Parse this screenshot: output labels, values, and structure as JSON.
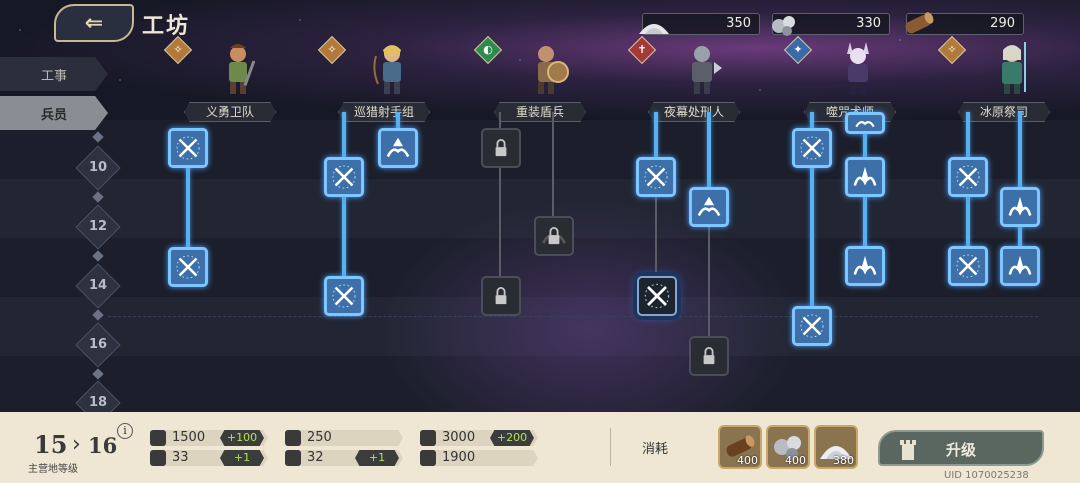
{
  "header": {
    "title": "工坊",
    "back_label": "⇐"
  },
  "resources": [
    {
      "name": "silver-sand",
      "value": "350"
    },
    {
      "name": "iron-ore",
      "value": "330"
    },
    {
      "name": "wood",
      "value": "290"
    }
  ],
  "tabs": [
    {
      "label": "工事",
      "selected": false
    },
    {
      "label": "兵员",
      "selected": true
    }
  ],
  "levels": [
    "10",
    "12",
    "14",
    "16",
    "18"
  ],
  "heroes": [
    {
      "name": "义勇卫队",
      "badge": "✧",
      "badge_color": "#b27a3a"
    },
    {
      "name": "巡猎射手组",
      "badge": "✧",
      "badge_color": "#b27a3a"
    },
    {
      "name": "重装盾兵",
      "badge": "◐",
      "badge_color": "#2f8a4f"
    },
    {
      "name": "夜幕处刑人",
      "badge": "✝",
      "badge_color": "#a23a3a"
    },
    {
      "name": "噬咒术师",
      "badge": "✦",
      "badge_color": "#3a6aa8"
    },
    {
      "name": "冰原祭司",
      "badge": "✧",
      "badge_color": "#b27a3a"
    }
  ],
  "bottom": {
    "current_level": "15",
    "next_level": "16",
    "level_label": "主营地等级",
    "info_label": "i",
    "stats": [
      {
        "icon": "sword-icon",
        "value": "1500",
        "bonus": "+100"
      },
      {
        "icon": "shield-icon",
        "value": "250",
        "bonus": ""
      },
      {
        "icon": "heart-icon",
        "value": "3000",
        "bonus": "+200"
      },
      {
        "icon": "boot-icon",
        "value": "33",
        "bonus": "+1"
      },
      {
        "icon": "helmet-icon",
        "value": "32",
        "bonus": "+1"
      },
      {
        "icon": "eye-icon",
        "value": "1900",
        "bonus": ""
      }
    ],
    "consume_label": "消耗",
    "costs": [
      {
        "name": "wood",
        "value": "400"
      },
      {
        "name": "iron-ore",
        "value": "400"
      },
      {
        "name": "silver-sand",
        "value": "380"
      }
    ],
    "upgrade_label": "升级",
    "uid": "UID 1070025238"
  },
  "colors": {
    "node_active": "#3d6fa8",
    "line_active": "#58b1f0",
    "bonus_text": "#b6e05a"
  }
}
